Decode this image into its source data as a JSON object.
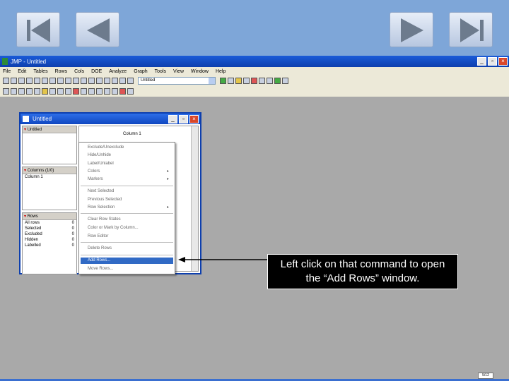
{
  "app": {
    "title": "JMP - Untitled",
    "menu": [
      "File",
      "Edit",
      "Tables",
      "Rows",
      "Cols",
      "DOE",
      "Analyze",
      "Graph",
      "Tools",
      "View",
      "Window",
      "Help"
    ],
    "combo_value": "Untitled"
  },
  "window": {
    "title": "Untitled",
    "table_panel_label": "Untitled",
    "columns_panel_label": "Columns (1/0)",
    "column_item": "Column 1",
    "column_header": "Column 1",
    "rows_panel_label": "Rows",
    "rows_stats": [
      {
        "label": "All rows",
        "value": "0"
      },
      {
        "label": "Selected",
        "value": "0"
      },
      {
        "label": "Excluded",
        "value": "0"
      },
      {
        "label": "Hidden",
        "value": "0"
      },
      {
        "label": "Labelled",
        "value": "0"
      }
    ]
  },
  "context_menu": {
    "items": [
      "Exclude/Unexclude",
      "Hide/Unhide",
      "Label/Unlabel",
      "Colors",
      "Markers",
      "Next Selected",
      "Previous Selected",
      "Row Selection",
      "Clear Row States",
      "Color or Mark by Column...",
      "Row Editor",
      "Delete Rows",
      "Add Rows...",
      "Move Rows..."
    ],
    "selected": "Add Rows..."
  },
  "callout": {
    "text": "Left click on that command to open the “Add Rows” window."
  },
  "status": {
    "page": "5/12"
  }
}
